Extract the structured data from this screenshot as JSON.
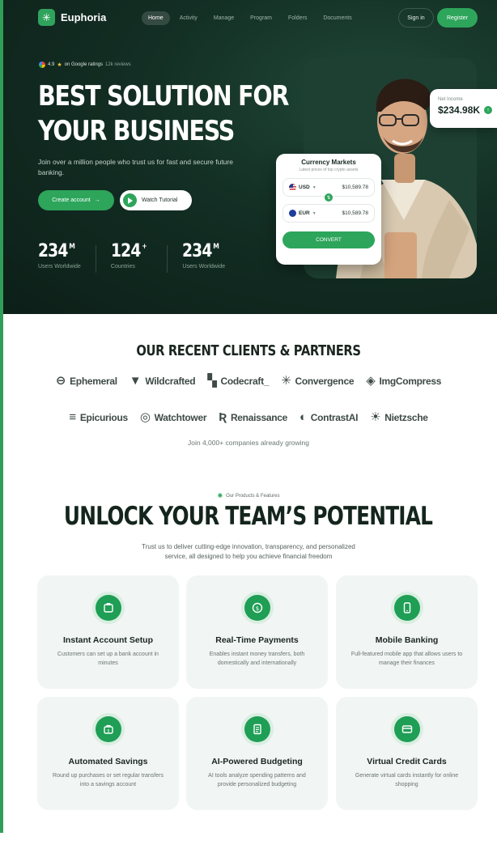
{
  "brand": {
    "name": "Euphoria"
  },
  "nav": {
    "items": [
      {
        "label": "Home",
        "active": true
      },
      {
        "label": "Activity",
        "active": false
      },
      {
        "label": "Manage",
        "active": false
      },
      {
        "label": "Program",
        "active": false
      },
      {
        "label": "Folders",
        "active": false
      },
      {
        "label": "Documents",
        "active": false
      }
    ],
    "signin": "Sign in",
    "register": "Register"
  },
  "hero": {
    "rating_value": "4.9",
    "rating_text": "on Google ratings",
    "rating_reviews": "12k reviews",
    "headline_line1": "BEST SOLUTION FOR",
    "headline_line2": "YOUR BUSINESS",
    "subtext": "Join over a million people who trust us for fast and secure future banking.",
    "cta_primary": "Create account",
    "cta_secondary": "Watch Tutorial",
    "stats": [
      {
        "value": "234",
        "suffix": "M",
        "label": "Users Worldwide"
      },
      {
        "value": "124",
        "suffix": "+",
        "label": "Countries"
      },
      {
        "value": "234",
        "suffix": "M",
        "label": "Users Worldwide"
      }
    ]
  },
  "net_income": {
    "label": "Net Income",
    "value": "$234.98K"
  },
  "currency_card": {
    "title": "Currency Markets",
    "subtitle": "Latest prices of top crypto assets",
    "rows": [
      {
        "currency": "USD",
        "amount": "$10,589.78"
      },
      {
        "currency": "EUR",
        "amount": "$10,589.78"
      }
    ],
    "button": "CONVERT"
  },
  "clients": {
    "title": "OUR RECENT CLIENTS & PARTNERS",
    "row1": [
      {
        "name": "Ephemeral",
        "icon": "ring-icon"
      },
      {
        "name": "Wildcrafted",
        "icon": "wings-icon"
      },
      {
        "name": "Codecraft_",
        "icon": "blocks-icon"
      },
      {
        "name": "Convergence",
        "icon": "burst-icon"
      },
      {
        "name": "ImgCompress",
        "icon": "diamond-icon"
      }
    ],
    "row2": [
      {
        "name": "Epicurious",
        "icon": "stack-icon"
      },
      {
        "name": "Watchtower",
        "icon": "swirl-icon"
      },
      {
        "name": "Renaissance",
        "icon": "r-icon"
      },
      {
        "name": "ContrastAI",
        "icon": "half-circle-icon"
      },
      {
        "name": "Nietzsche",
        "icon": "sun-icon"
      }
    ],
    "join_text": "Join 4,000+ companies already growing"
  },
  "features": {
    "eyebrow": "Our Products & Features",
    "title": "UNLOCK YOUR TEAM’S POTENTIAL",
    "subtitle": "Trust us to deliver cutting-edge innovation, transparency, and personalized service, all designed to help you achieve financial freedom",
    "cards": [
      {
        "title": "Instant Account Setup",
        "desc": "Customers can set up a bank account in minutes",
        "icon": "account-icon"
      },
      {
        "title": "Real-Time Payments",
        "desc": "Enables instant money transfers, both domestically and internationally",
        "icon": "payment-icon"
      },
      {
        "title": "Mobile Banking",
        "desc": "Full-featured mobile app that allows users to manage their finances",
        "icon": "phone-icon"
      },
      {
        "title": "Automated Savings",
        "desc": "Round up purchases or set regular transfers into a savings account",
        "icon": "savings-icon"
      },
      {
        "title": "AI-Powered Budgeting",
        "desc": "AI tools analyze spending patterns and provide personalized budgeting",
        "icon": "budget-icon"
      },
      {
        "title": "Virtual Credit Cards",
        "desc": "Generate virtual cards instantly for online shopping",
        "icon": "card-icon"
      }
    ]
  },
  "colors": {
    "accent": "#2da55b",
    "hero_bg": "#132e24",
    "card_bg": "#f1f5f3"
  }
}
